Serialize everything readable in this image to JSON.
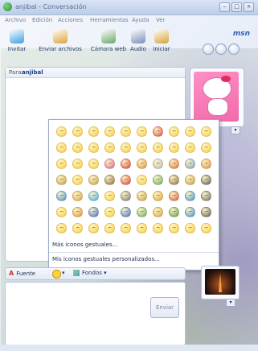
{
  "window": {
    "title": "anjibal - Conversación",
    "minimize_glyph": "‒",
    "maximize_glyph": "□",
    "close_glyph": "×"
  },
  "menu": {
    "items": [
      "Archivo",
      "Edición",
      "Acciones",
      "Herramientas",
      "Ayuda",
      "Ver"
    ]
  },
  "toolbar": {
    "items": [
      {
        "label": "Invitar",
        "icon": "invite-icon",
        "color": "#3aa0e0"
      },
      {
        "label": "Enviar archivos",
        "icon": "send-files-icon",
        "color": "#e0a23a"
      },
      {
        "label": "Cámara web",
        "icon": "webcam-icon",
        "color": "#6aa86a"
      },
      {
        "label": "Audio",
        "icon": "audio-icon",
        "color": "#7a8fb8"
      },
      {
        "label": "Iniciar",
        "icon": "start-icon",
        "color": "#d6a43a"
      }
    ],
    "brand": "msn"
  },
  "conversation": {
    "to_label": "Para:",
    "to_value": "anjibal"
  },
  "emoticon_picker": {
    "emoticon_colors": [
      "#ffcf33",
      "#ffcf33",
      "#ffcf33",
      "#ffcf33",
      "#ffcf33",
      "#ffcf33",
      "#e04a3a",
      "#ffcf33",
      "#ffcf33",
      "#ffcf33",
      "#ffcf33",
      "#ffcf33",
      "#ffcf33",
      "#ffcf33",
      "#ffcf33",
      "#ffcf33",
      "#ffcf33",
      "#ffcf33",
      "#ffcf33",
      "#ffcf33",
      "#ffcf33",
      "#ffcf33",
      "#ffcf33",
      "#e35d8f",
      "#e03a3a",
      "#e0903a",
      "#bbbbbb",
      "#e06a3a",
      "#7a9fd0",
      "#e0903a",
      "#c8a040",
      "#ffcf33",
      "#c8a040",
      "#8c6b46",
      "#e03a3a",
      "#ffcf33",
      "#6aa86a",
      "#8c6b46",
      "#c8a040",
      "#5a5a5a",
      "#3a8fd6",
      "#d6a43a",
      "#3ab0e0",
      "#ffcf33",
      "#7a7a7a",
      "#c8a040",
      "#e0a23a",
      "#d05a3a",
      "#3a8fd6",
      "#6a6a6a",
      "#ffcf33",
      "#e0903a",
      "#3a6ad6",
      "#ffcf33",
      "#3a6ad6",
      "#6aa86a",
      "#d6a43a",
      "#5a9a4a",
      "#3a8fd6",
      "#5a5a5a",
      "#ffcf33",
      "#ffcf33",
      "#ffcf33",
      "#ffcf33",
      "#ffcf33",
      "#ffcf33",
      "#ffcf33",
      "#ffcf33",
      "#ffcf33",
      "#ffcf33"
    ],
    "more_link": "Más iconos gestuales...",
    "custom_link": "Mis iconos gestuales personalizados..."
  },
  "format_bar": {
    "font_glyph": "A",
    "font_label": "Fuente",
    "emoticon_dropdown_glyph": "▾",
    "backgrounds_label": "Fondos ▾"
  },
  "send_button": "Enviar",
  "dropdown_glyph": "▾"
}
